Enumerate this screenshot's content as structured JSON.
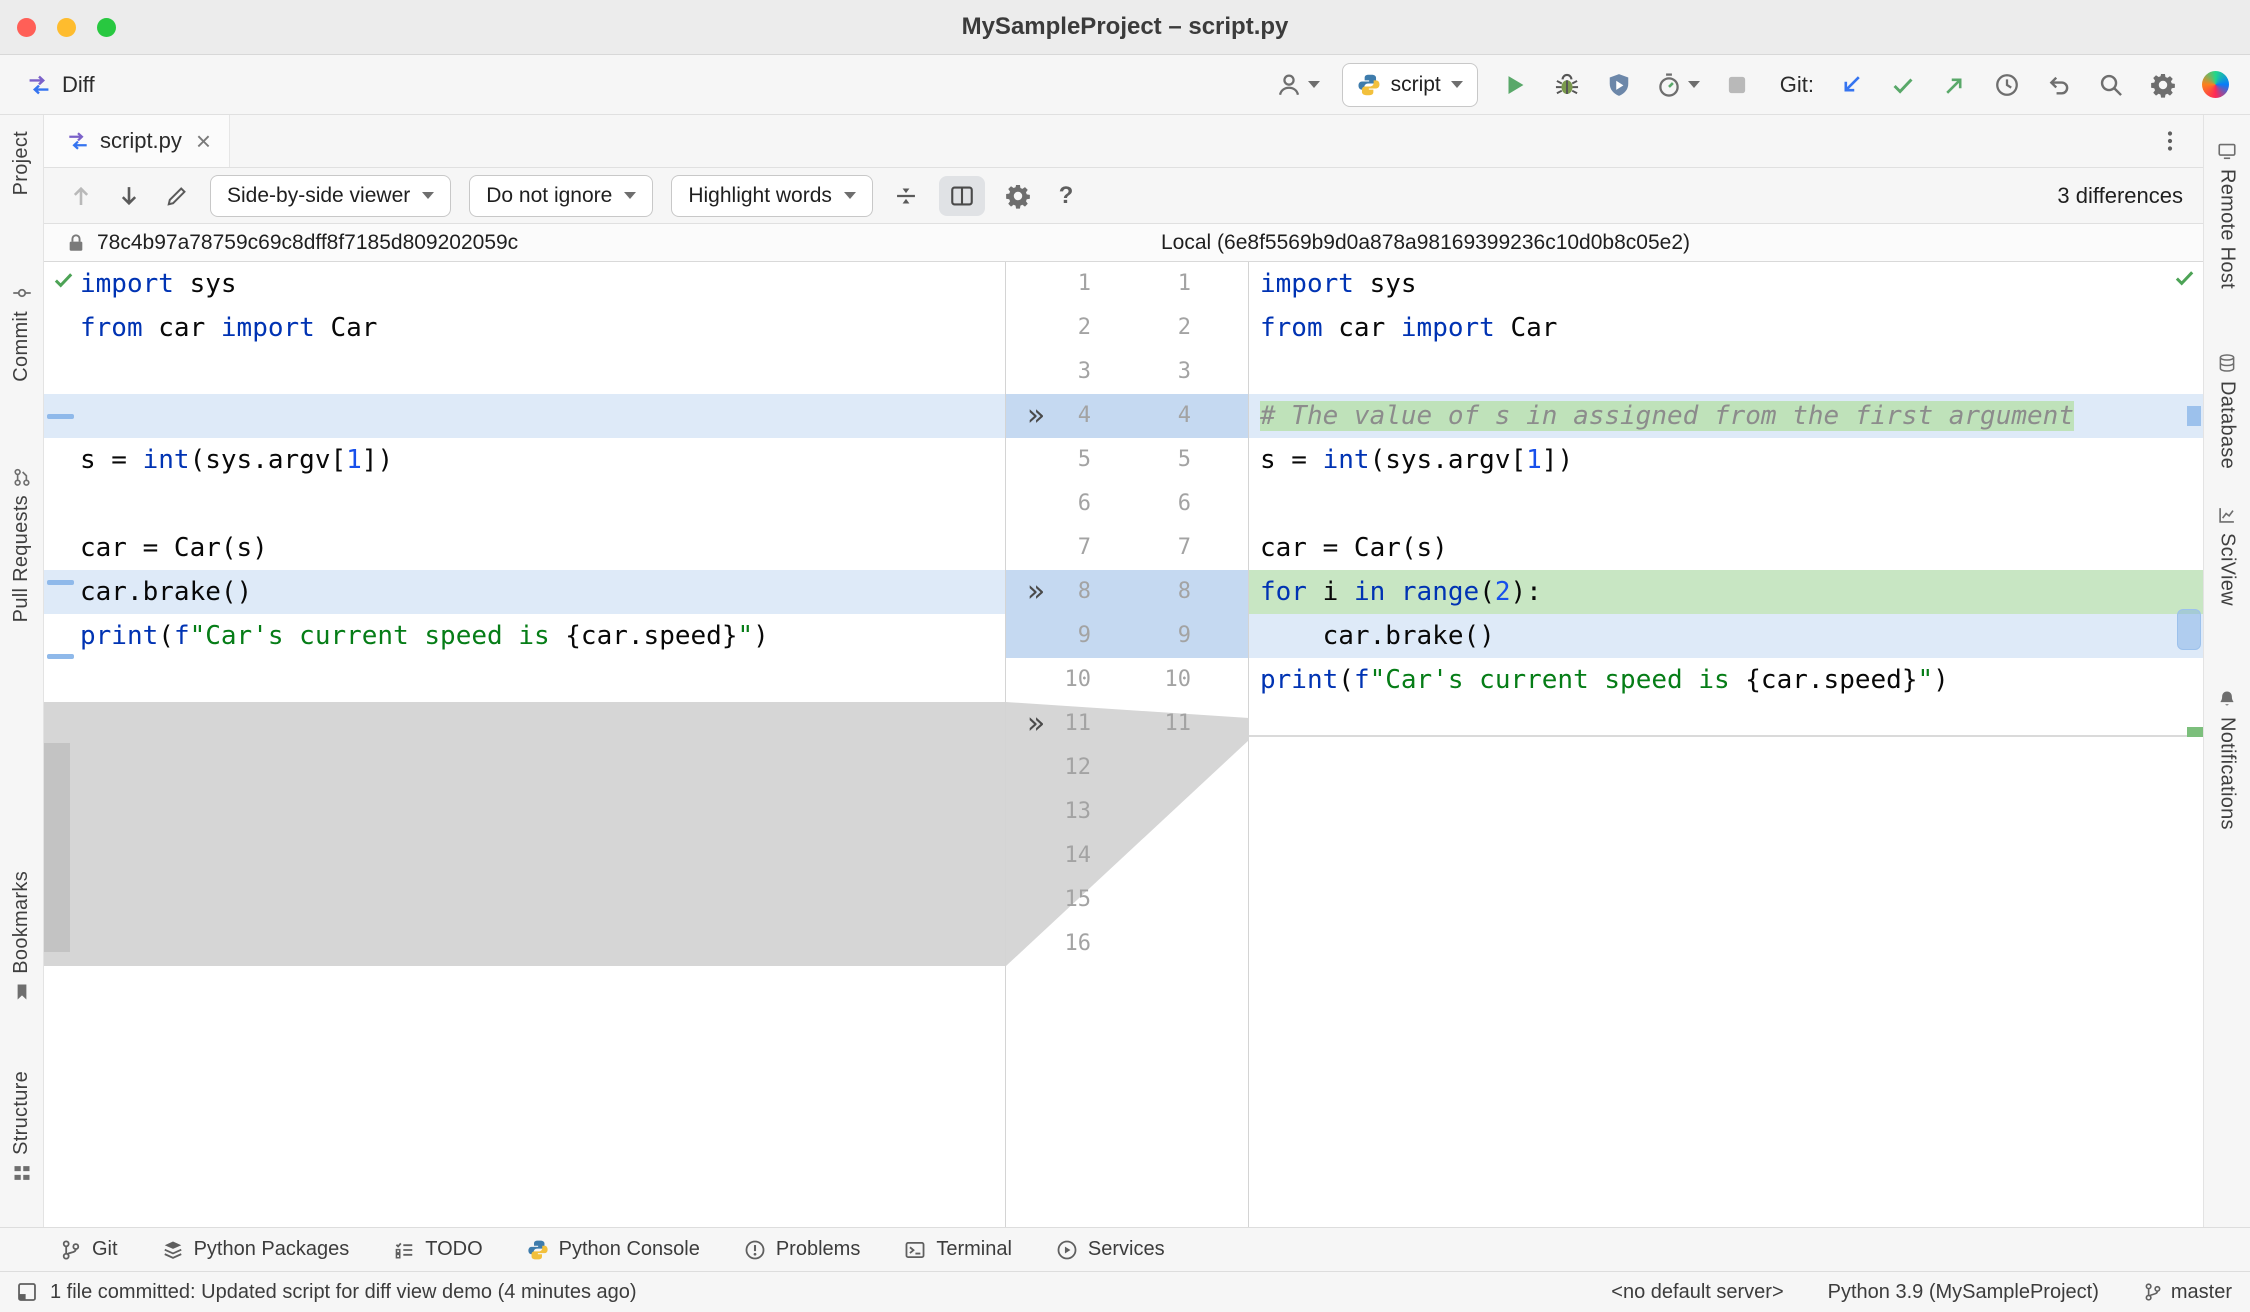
{
  "colors": {
    "accent_blue": "#3574F0",
    "added_line_green": "#C8E6C3",
    "changed_line_blue": "#DEEAF8",
    "inline_added_green": "#BFE2BA",
    "gutter_change_blue": "#C5D9F1",
    "folded_region_gray": "#D6D6D6",
    "keyword": "#0033B3",
    "string": "#067D17",
    "number": "#1750EB",
    "comment": "#8C8C8C"
  },
  "titlebar": {
    "title": "MySampleProject – script.py"
  },
  "toolbar": {
    "breadcrumb": "Diff",
    "run_config": "script",
    "git_label": "Git:"
  },
  "tab": {
    "label": "script.py"
  },
  "left_stripe": {
    "items": [
      {
        "id": "project",
        "label": "Project",
        "icon": "folder-icon"
      },
      {
        "id": "commit",
        "label": "Commit",
        "icon": "commit-icon"
      },
      {
        "id": "pull-requests",
        "label": "Pull Requests",
        "icon": "pull-request-icon"
      },
      {
        "id": "bookmarks",
        "label": "Bookmarks",
        "icon": "bookmark-icon"
      },
      {
        "id": "structure",
        "label": "Structure",
        "icon": "structure-icon"
      }
    ]
  },
  "right_stripe": {
    "items": [
      {
        "id": "remote-host",
        "label": "Remote Host",
        "icon": "monitor-icon"
      },
      {
        "id": "database",
        "label": "Database",
        "icon": "database-icon"
      },
      {
        "id": "sciview",
        "label": "SciView",
        "icon": "sciview-icon"
      },
      {
        "id": "notifications",
        "label": "Notifications",
        "icon": "bell-icon"
      }
    ]
  },
  "diff_toolbar": {
    "viewer_mode": "Side-by-side viewer",
    "ignore_policy": "Do not ignore",
    "highlight_mode": "Highlight words",
    "differences": "3 differences"
  },
  "diff_headers": {
    "left": "78c4b97a78759c69c8dff8f7185d809202059c",
    "right": "Local (6e8f5569b9d0a878a98169399236c10d0b8c05e2)"
  },
  "diff": {
    "left_lines": [
      {
        "tokens": [
          {
            "c": "kw",
            "t": "import"
          },
          {
            "c": "pl",
            "t": " sys"
          }
        ]
      },
      {
        "tokens": [
          {
            "c": "kw",
            "t": "from"
          },
          {
            "c": "pl",
            "t": " car "
          },
          {
            "c": "kw",
            "t": "import"
          },
          {
            "c": "pl",
            "t": " Car"
          }
        ]
      },
      {
        "tokens": []
      },
      {
        "hl": "blue",
        "tokens": []
      },
      {
        "tokens": [
          {
            "c": "pl",
            "t": "s = "
          },
          {
            "c": "kw",
            "t": "int"
          },
          {
            "c": "pl",
            "t": "(sys.argv["
          },
          {
            "c": "num",
            "t": "1"
          },
          {
            "c": "pl",
            "t": "])"
          }
        ]
      },
      {
        "tokens": []
      },
      {
        "tokens": [
          {
            "c": "pl",
            "t": "car = Car(s)"
          }
        ]
      },
      {
        "hl": "blue",
        "tokens": [
          {
            "c": "pl",
            "t": "car.brake()"
          }
        ]
      },
      {
        "tokens": [
          {
            "c": "kw",
            "t": "print"
          },
          {
            "c": "pl",
            "t": "("
          },
          {
            "c": "kw",
            "t": "f"
          },
          {
            "c": "str",
            "t": "\"Car's current speed is "
          },
          {
            "c": "pl",
            "t": "{car.speed}"
          },
          {
            "c": "str",
            "t": "\""
          },
          {
            "c": "pl",
            "t": ")"
          }
        ]
      },
      {
        "tokens": []
      },
      {
        "tokens": []
      },
      {
        "tokens": []
      },
      {
        "tokens": []
      },
      {
        "tokens": []
      },
      {
        "tokens": []
      },
      {
        "tokens": []
      }
    ],
    "right_lines": [
      {
        "tokens": [
          {
            "c": "kw",
            "t": "import"
          },
          {
            "c": "pl",
            "t": " sys"
          }
        ]
      },
      {
        "tokens": [
          {
            "c": "kw",
            "t": "from"
          },
          {
            "c": "pl",
            "t": " car "
          },
          {
            "c": "kw",
            "t": "import"
          },
          {
            "c": "pl",
            "t": " Car"
          }
        ]
      },
      {
        "tokens": []
      },
      {
        "hl": "blue",
        "tokens": [
          {
            "c": "cmt",
            "t": "# The value of s in assigned from the first argument",
            "bg": "green"
          }
        ]
      },
      {
        "tokens": [
          {
            "c": "pl",
            "t": "s = "
          },
          {
            "c": "kw",
            "t": "int"
          },
          {
            "c": "pl",
            "t": "(sys.argv["
          },
          {
            "c": "num",
            "t": "1"
          },
          {
            "c": "pl",
            "t": "])"
          }
        ]
      },
      {
        "tokens": []
      },
      {
        "tokens": [
          {
            "c": "pl",
            "t": "car = Car(s)"
          }
        ]
      },
      {
        "hl": "green",
        "tokens": [
          {
            "c": "kw",
            "t": "for"
          },
          {
            "c": "pl",
            "t": " i "
          },
          {
            "c": "kw",
            "t": "in"
          },
          {
            "c": "pl",
            "t": " "
          },
          {
            "c": "kw",
            "t": "range"
          },
          {
            "c": "pl",
            "t": "("
          },
          {
            "c": "num",
            "t": "2"
          },
          {
            "c": "pl",
            "t": "):"
          }
        ]
      },
      {
        "hl": "blue",
        "tokens": [
          {
            "c": "pl",
            "t": "    car.brake()"
          }
        ]
      },
      {
        "tokens": [
          {
            "c": "kw",
            "t": "print"
          },
          {
            "c": "pl",
            "t": "("
          },
          {
            "c": "kw",
            "t": "f"
          },
          {
            "c": "str",
            "t": "\"Car's current speed is "
          },
          {
            "c": "pl",
            "t": "{car.speed}"
          },
          {
            "c": "str",
            "t": "\""
          },
          {
            "c": "pl",
            "t": ")"
          }
        ]
      },
      {
        "tokens": []
      }
    ],
    "gutter": {
      "rows": [
        {
          "l": "1",
          "r": "1"
        },
        {
          "l": "2",
          "r": "2"
        },
        {
          "l": "3",
          "r": "3"
        },
        {
          "l": "4",
          "r": "4"
        },
        {
          "l": "5",
          "r": "5"
        },
        {
          "l": "6",
          "r": "6"
        },
        {
          "l": "7",
          "r": "7"
        },
        {
          "l": "8",
          "r": "8"
        },
        {
          "l": "9",
          "r": "9"
        },
        {
          "l": "10",
          "r": "10"
        },
        {
          "l": "11",
          "r": "11"
        },
        {
          "l": "12",
          "r": ""
        },
        {
          "l": "13",
          "r": ""
        },
        {
          "l": "14",
          "r": ""
        },
        {
          "l": "15",
          "r": ""
        },
        {
          "l": "16",
          "r": ""
        }
      ],
      "chevron_rows": [
        4,
        8,
        11
      ],
      "blue_rows": [
        4,
        8,
        9
      ]
    }
  },
  "bottom_bar": {
    "items": [
      {
        "id": "git",
        "label": "Git",
        "icon": "git-branch-icon"
      },
      {
        "id": "python-packages",
        "label": "Python Packages",
        "icon": "packages-icon"
      },
      {
        "id": "todo",
        "label": "TODO",
        "icon": "todo-icon"
      },
      {
        "id": "python-console",
        "label": "Python Console",
        "icon": "python-icon"
      },
      {
        "id": "problems",
        "label": "Problems",
        "icon": "problems-icon"
      },
      {
        "id": "terminal",
        "label": "Terminal",
        "icon": "terminal-icon"
      },
      {
        "id": "services",
        "label": "Services",
        "icon": "services-icon"
      }
    ]
  },
  "status_bar": {
    "message": "1 file committed: Updated script for diff view demo (4 minutes ago)",
    "server": "<no default server>",
    "interpreter": "Python 3.9 (MySampleProject)",
    "branch": "master"
  }
}
